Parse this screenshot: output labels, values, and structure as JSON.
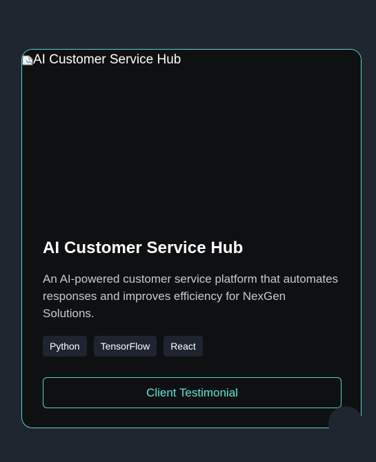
{
  "project_card": {
    "image_alt": "AI Customer Service Hub",
    "title": "AI Customer Service Hub",
    "description": "An AI-powered customer service platform that automates responses and improves efficiency for NexGen Solutions.",
    "tags": [
      "Python",
      "TensorFlow",
      "React"
    ],
    "testimonial_button": "Client Testimonial"
  },
  "icons": {
    "broken_image": "broken-image-icon",
    "floating_control": "round-floating-control"
  },
  "colors": {
    "background": "#1f2630",
    "card_background": "#0f1012",
    "accent": "#55d6c9",
    "accent_text": "#55e7da",
    "tag_background": "#1e2430",
    "body_text": "#c9c9c9"
  }
}
